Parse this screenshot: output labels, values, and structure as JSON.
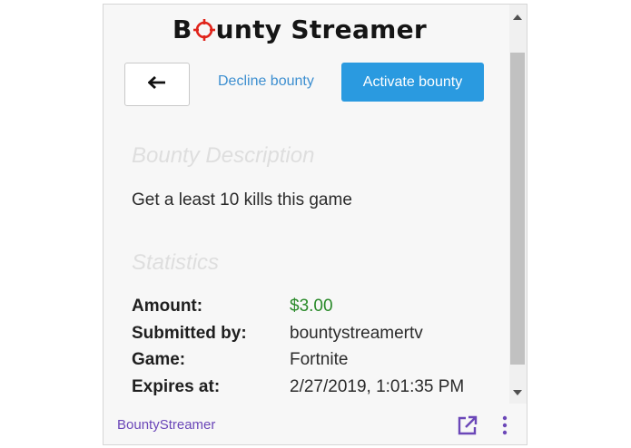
{
  "header": {
    "logo_text_before": "B",
    "logo_text_after": "unty Streamer"
  },
  "actions": {
    "back_icon": "arrow-left-icon",
    "decline_label": "Decline bounty",
    "activate_label": "Activate bounty"
  },
  "bounty": {
    "description_title": "Bounty Description",
    "description_text": "Get a least 10 kills this game",
    "statistics_title": "Statistics",
    "stats": [
      {
        "label": "Amount:",
        "value": "$3.00"
      },
      {
        "label": "Submitted by:",
        "value": "bountystreamertv"
      },
      {
        "label": "Game:",
        "value": "Fortnite"
      },
      {
        "label": "Expires at:",
        "value": "2/27/2019, 1:01:35 PM"
      }
    ]
  },
  "footer": {
    "brand_label": "BountyStreamer",
    "popout_icon": "popout-icon",
    "menu_icon": "more-vertical-icon"
  },
  "colors": {
    "accent": "#2a9ae0",
    "link": "#3d8fd0",
    "money": "#2a8a2a",
    "brand_purple": "#6b47b8"
  }
}
